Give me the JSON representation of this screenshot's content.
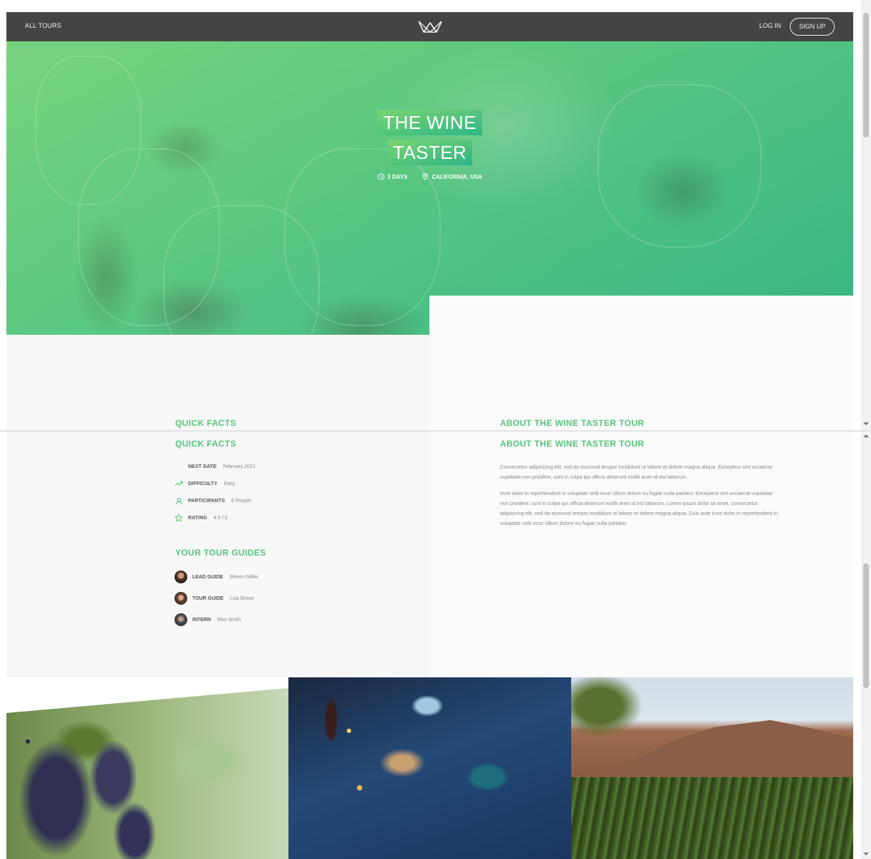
{
  "header": {
    "all_tours": "ALL TOURS",
    "login": "LOG IN",
    "signup": "SIGN UP"
  },
  "hero": {
    "title_line1": "THE WINE",
    "title_line2": "TASTER",
    "duration": "3 DAYS",
    "location": "CALIFORNIA, USA"
  },
  "quick_facts": {
    "heading": "QUICK FACTS",
    "items": [
      {
        "label": "NEXT DATE",
        "value": "February 2021",
        "icon": "calendar-icon"
      },
      {
        "label": "DIFFICULTY",
        "value": "Easy",
        "icon": "trending-up-icon"
      },
      {
        "label": "PARTICIPANTS",
        "value": "8 People",
        "icon": "user-icon"
      },
      {
        "label": "RATING",
        "value": "4.5 / 5",
        "icon": "star-icon"
      }
    ]
  },
  "guides": {
    "heading": "YOUR TOUR GUIDES",
    "items": [
      {
        "label": "LEAD GUIDE",
        "value": "Steven Miller"
      },
      {
        "label": "TOUR GUIDE",
        "value": "Lisa Brown"
      },
      {
        "label": "INTERN",
        "value": "Max Smith"
      }
    ]
  },
  "about": {
    "heading": "ABOUT THE WINE TASTER TOUR",
    "paragraph1": "Consectetur adipisicing elit, sed do eiusmod tempor incididunt ut labore et dolore magna aliqua. Excepteur sint occaecat cupidatat non proident, sunt in culpa qui officia deserunt mollit anim id est laborum.",
    "paragraph2": "Irure dolor in reprehenderit in voluptate velit esse cillum dolore eu fugiat nulla pariatur. Excepteur sint occaecat cupidatat non proident, sunt in culpa qui officia deserunt mollit anim id est laborum. Lorem ipsum dolor sit amet, consectetur adipisicing elit, sed do eiusmod tempor incididunt ut labore et dolore magna aliqua. Duis aute irure dolor in reprehenderit in voluptate velit esse cillum dolore eu fugiat nulla pariatur."
  },
  "colors": {
    "brand_green": "#55c57a",
    "header_bg": "#444444",
    "section_gray": "#f7f7f7"
  }
}
